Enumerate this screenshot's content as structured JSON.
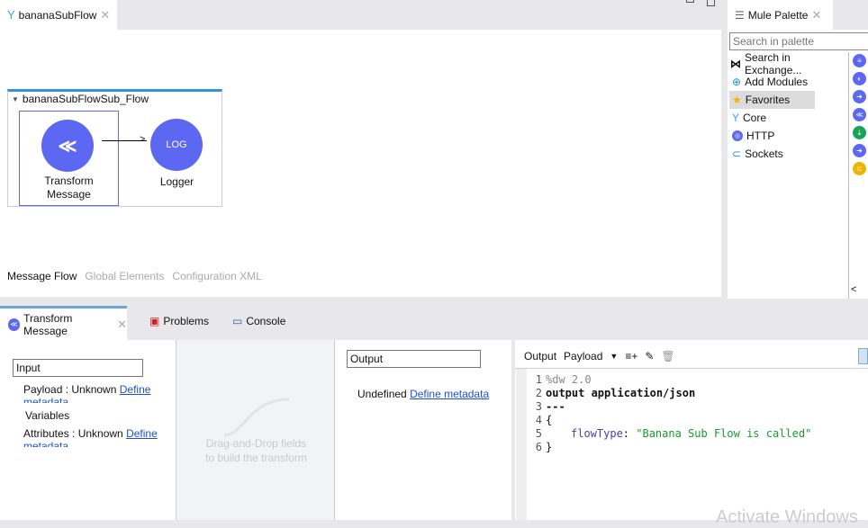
{
  "editor": {
    "tab_label": "bananaSubFlow",
    "flow_name": "bananaSubFlowSub_Flow",
    "nodes": [
      {
        "label1": "Transform",
        "label2": "Message"
      },
      {
        "label1": "Logger",
        "icon_text": "LOG"
      }
    ],
    "bottom_tabs": [
      "Message Flow",
      "Global Elements",
      "Configuration XML"
    ]
  },
  "palette": {
    "tab_label": "Mule Palette",
    "search_placeholder": "Search in palette",
    "items": [
      "Search in Exchange...",
      "Add Modules",
      "Favorites",
      "Core",
      "HTTP",
      "Sockets"
    ]
  },
  "panel_tabs": [
    "Transform Message",
    "Problems",
    "Console"
  ],
  "transform": {
    "input_label": "Input",
    "output_label": "Output",
    "input_items": [
      {
        "name": "Payload : Unknown",
        "link": "Define metadata"
      },
      {
        "name": "Variables"
      },
      {
        "name": "Attributes : Unknown",
        "link": "Define metadata"
      }
    ],
    "drag_hint1": "Drag-and-Drop fields",
    "drag_hint2": "to build the transform",
    "output_undefined": "Undefined",
    "output_link": "Define metadata",
    "editor_output": "Output",
    "editor_target": "Payload",
    "code": [
      {
        "n": "1",
        "text": "%dw 2.0"
      },
      {
        "n": "2",
        "text": "output application/json"
      },
      {
        "n": "3",
        "text": "---"
      },
      {
        "n": "4",
        "text": "{"
      },
      {
        "n": "5",
        "key": "flowType",
        "sep": ": ",
        "str": "\"Banana Sub Flow is called\""
      },
      {
        "n": "6",
        "text": "}"
      }
    ]
  },
  "watermark": "Activate Windows"
}
